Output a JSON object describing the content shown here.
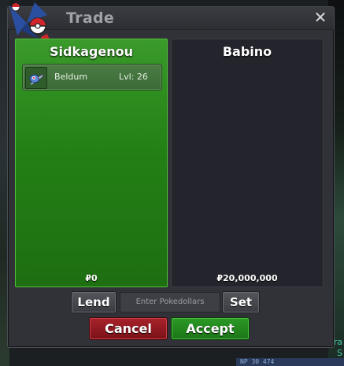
{
  "window": {
    "title": "Trade",
    "close_symbol": "✕"
  },
  "left_panel": {
    "player": "Sidkagenou",
    "items": [
      {
        "name": "Beldum",
        "level": "Lvl: 26"
      }
    ],
    "money": "₽0"
  },
  "right_panel": {
    "player": "Babino",
    "money": "₽20,000,000"
  },
  "controls": {
    "lend_label": "Lend",
    "pokedollars_placeholder": "Enter Pokedollars",
    "set_label": "Set",
    "cancel_label": "Cancel",
    "accept_label": "Accept"
  },
  "background": {
    "right_labels": [
      "Tra",
      "S"
    ],
    "bottom_text": "NP 30 474"
  },
  "colors": {
    "accent_green": "#238015",
    "cancel_red": "#a8222a",
    "accept_green": "#2c9a26",
    "window_bg": "#303238"
  },
  "icons": {
    "logo": "pokeball-logo-icon",
    "pokemon": "beldum-icon",
    "close": "close-icon"
  }
}
